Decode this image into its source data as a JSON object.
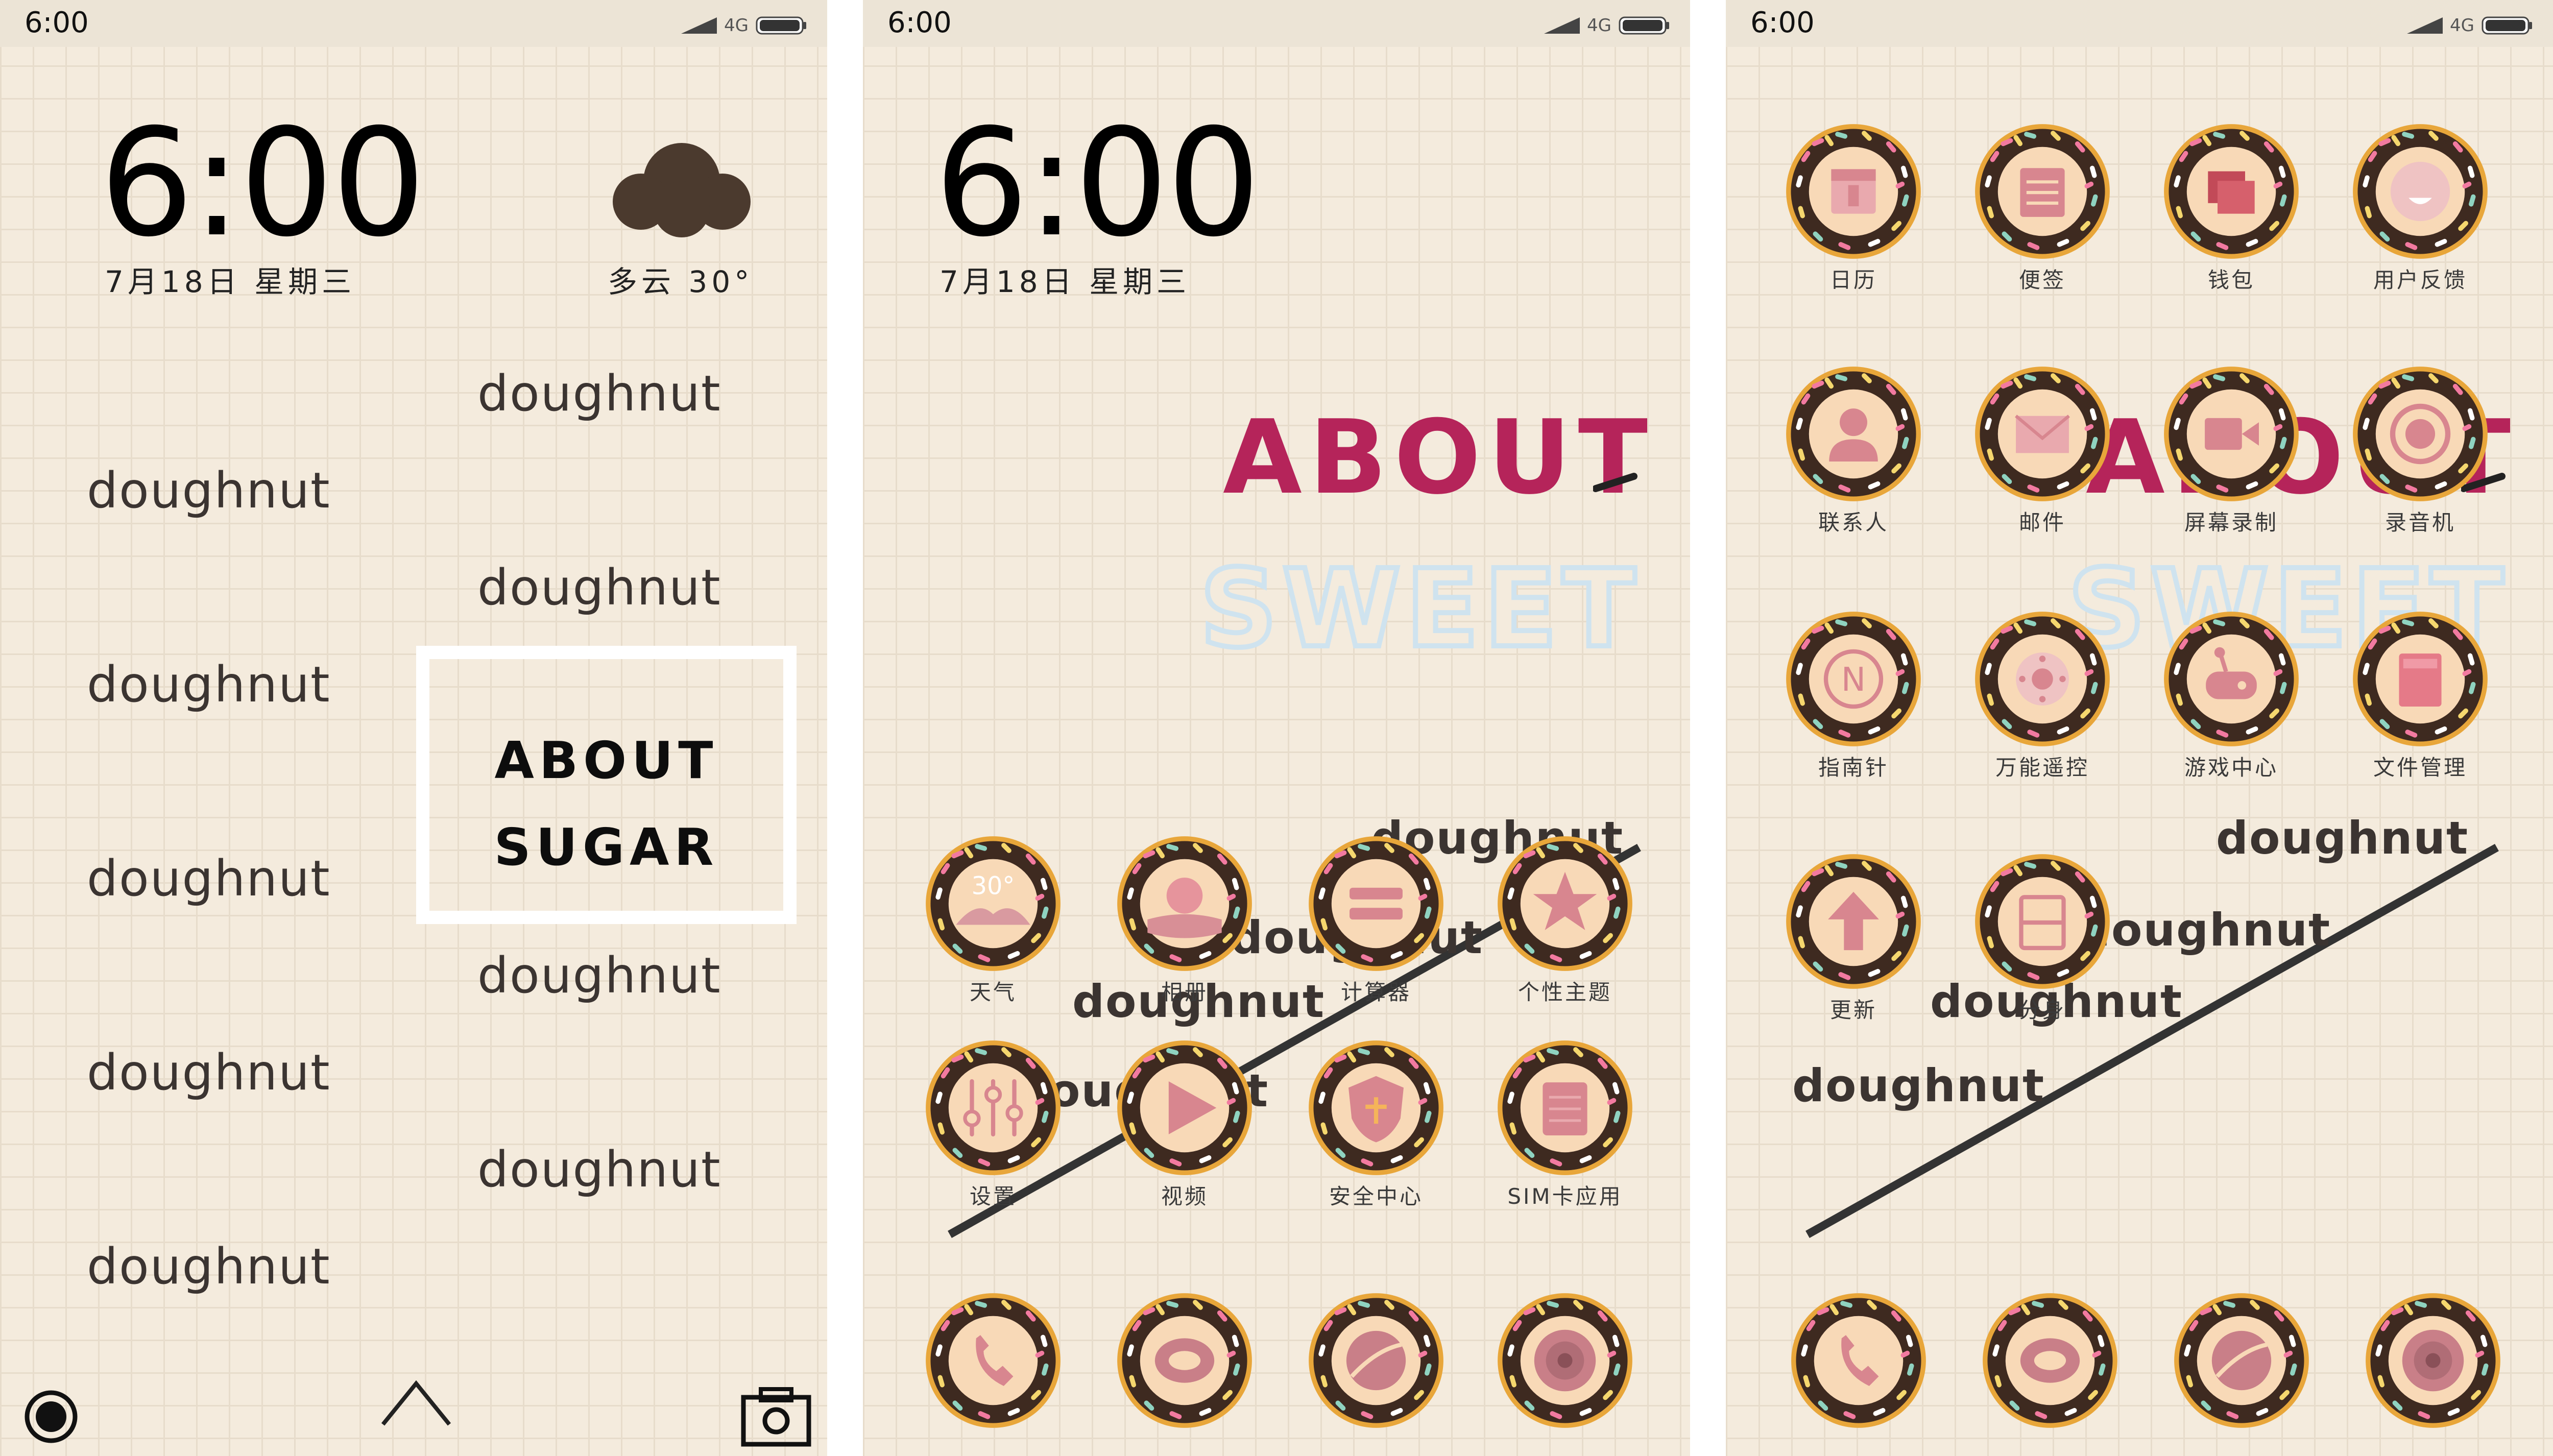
{
  "colors": {
    "background": "#f4ebdd",
    "grid": "#e7dccb",
    "donut_frosting": "#3e2a20",
    "donut_dough": "#e8a63a",
    "donut_center": "#f8d9b7",
    "icon_pink": "#e6949c",
    "about_red": "#b5245a",
    "sweet_blue": "#cfe3ef",
    "text_dark": "#3b3431"
  },
  "status_bar": {
    "time": "6:00",
    "network": "4G"
  },
  "lock_screen": {
    "time": "6:00",
    "date": "7月18日  星期三",
    "weather_icon": "cloud-icon",
    "weather_text": "多云 30°",
    "doughnut_word": "doughnut",
    "about_line1": "ABOUT",
    "about_line2": "SUGAR",
    "bottom_icons": [
      "record-icon",
      "chevron-up-icon",
      "camera-icon"
    ]
  },
  "home_screen": {
    "time": "6:00",
    "date": "7月18日  星期三",
    "about": "ABOUT",
    "sweet": "SWEET",
    "doughnut_word": "doughnut",
    "apps": [
      {
        "label": "天气",
        "icon": "weather-icon",
        "badge": "30°"
      },
      {
        "label": "相册",
        "icon": "photos-icon"
      },
      {
        "label": "计算器",
        "icon": "calculator-icon"
      },
      {
        "label": "个性主题",
        "icon": "theme-icon"
      },
      {
        "label": "设置",
        "icon": "settings-icon"
      },
      {
        "label": "视频",
        "icon": "video-icon"
      },
      {
        "label": "安全中心",
        "icon": "security-icon"
      },
      {
        "label": "SIM卡应用",
        "icon": "sim-icon"
      }
    ],
    "dock": [
      {
        "icon": "phone-icon"
      },
      {
        "icon": "messages-icon"
      },
      {
        "icon": "browser-icon"
      },
      {
        "icon": "camera-lens-icon"
      }
    ]
  },
  "second_screen": {
    "about": "ABOUT",
    "sweet": "SWEET",
    "doughnut_word": "doughnut",
    "apps": [
      {
        "label": "日历",
        "icon": "calendar-icon"
      },
      {
        "label": "便签",
        "icon": "notes-icon"
      },
      {
        "label": "钱包",
        "icon": "wallet-icon"
      },
      {
        "label": "用户反馈",
        "icon": "feedback-icon"
      },
      {
        "label": "联系人",
        "icon": "contacts-icon"
      },
      {
        "label": "邮件",
        "icon": "mail-icon"
      },
      {
        "label": "屏幕录制",
        "icon": "screen-record-icon"
      },
      {
        "label": "录音机",
        "icon": "recorder-icon"
      },
      {
        "label": "指南针",
        "icon": "compass-icon"
      },
      {
        "label": "万能遥控",
        "icon": "remote-icon"
      },
      {
        "label": "游戏中心",
        "icon": "game-icon"
      },
      {
        "label": "文件管理",
        "icon": "files-icon"
      },
      {
        "label": "更新",
        "icon": "update-icon"
      },
      {
        "label": "分身",
        "icon": "dual-app-icon"
      }
    ],
    "dock": [
      {
        "icon": "phone-icon"
      },
      {
        "icon": "messages-icon"
      },
      {
        "icon": "browser-icon"
      },
      {
        "icon": "camera-lens-icon"
      }
    ]
  }
}
